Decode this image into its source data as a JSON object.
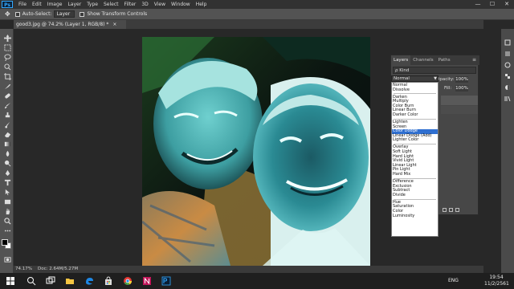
{
  "menubar": {
    "logo": "Ps",
    "items": [
      "File",
      "Edit",
      "Image",
      "Layer",
      "Type",
      "Select",
      "Filter",
      "3D",
      "View",
      "Window",
      "Help"
    ],
    "window_controls": [
      "—",
      "☐",
      "✕"
    ]
  },
  "options_bar": {
    "auto_select_label": "Auto-Select:",
    "auto_select_target": "Layer",
    "transform_label": "Show Transform Controls"
  },
  "document": {
    "tab_title": "good3.jpg @ 74.2% (Layer 1, RGB/8) *",
    "tab_close": "×"
  },
  "status": {
    "zoom": "74.17%",
    "doc_size": "Doc: 2.64M/5.27M"
  },
  "layers_panel": {
    "tabs": [
      "Layers",
      "Channels",
      "Paths"
    ],
    "filter": "ρ Kind",
    "opacity_label": "Opacity:",
    "opacity_value": "100%",
    "fill_label": "Fill:",
    "fill_value": "100%"
  },
  "blend_mode": {
    "current": "Normal",
    "selected": "Color Dodge",
    "groups": [
      [
        "Normal",
        "Dissolve"
      ],
      [
        "Darken",
        "Multiply",
        "Color Burn",
        "Linear Burn",
        "Darker Color"
      ],
      [
        "Lighten",
        "Screen",
        "Color Dodge",
        "Linear Dodge (Add)",
        "Lighter Color"
      ],
      [
        "Overlay",
        "Soft Light",
        "Hard Light",
        "Vivid Light",
        "Linear Light",
        "Pin Light",
        "Hard Mix"
      ],
      [
        "Difference",
        "Exclusion",
        "Subtract",
        "Divide"
      ],
      [
        "Hue",
        "Saturation",
        "Color",
        "Luminosity"
      ]
    ]
  },
  "taskbar": {
    "language": "ENG",
    "time": "19:54",
    "date": "11/2/2561",
    "apps": [
      "start-icon",
      "search-icon",
      "task-view-icon",
      "file-explorer-icon",
      "edge-icon",
      "store-icon",
      "chrome-icon",
      "app-n-icon",
      "photoshop-icon"
    ]
  },
  "colors": {
    "accent": "#31a8ff",
    "selected_option": "#2f6fd0",
    "app_bg": "#282828",
    "panel_bg": "#474747"
  }
}
